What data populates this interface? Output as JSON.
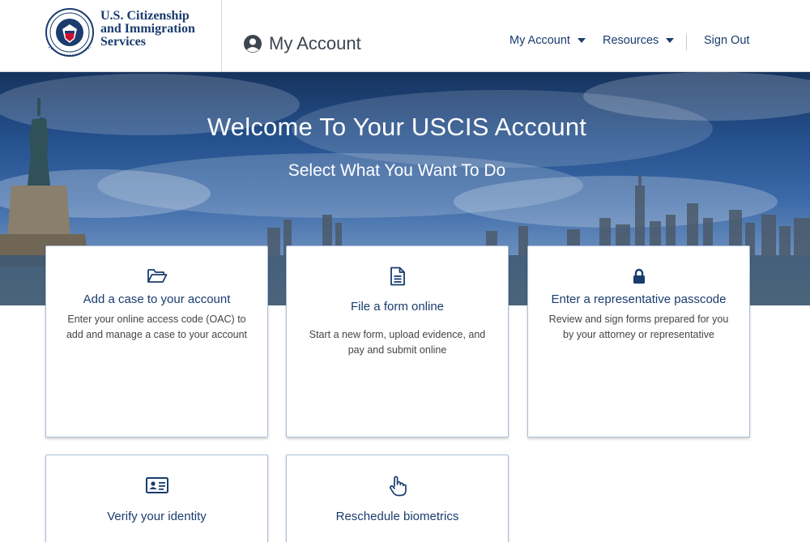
{
  "header": {
    "agency_line1": "U.S. Citizenship",
    "agency_line2": "and Immigration",
    "agency_line3": "Services",
    "seal_icon": "dhs-seal-icon",
    "page_title": "My Account",
    "nav": {
      "my_account": "My Account",
      "resources": "Resources",
      "sign_out": "Sign Out"
    }
  },
  "hero": {
    "title": "Welcome To Your USCIS Account",
    "subtitle": "Select What You Want To Do"
  },
  "cards": [
    {
      "icon": "folder-open-icon",
      "title": "Add a case to your account",
      "description": "Enter your online access code (OAC) to add and manage a case to your account"
    },
    {
      "icon": "document-icon",
      "title": "File a form online",
      "description": "Start a new form, upload evidence, and pay and submit online"
    },
    {
      "icon": "lock-icon",
      "title": "Enter a representative passcode",
      "description": "Review and sign forms prepared for you by your attorney or representative"
    },
    {
      "icon": "id-card-icon",
      "title": "Verify your identity",
      "description": ""
    },
    {
      "icon": "pointer-hand-icon",
      "title": "Reschedule biometrics",
      "description": ""
    }
  ],
  "colors": {
    "brand_navy": "#1a3c6e",
    "card_border": "#a9bfd8",
    "hero_sky": "#24508c"
  }
}
